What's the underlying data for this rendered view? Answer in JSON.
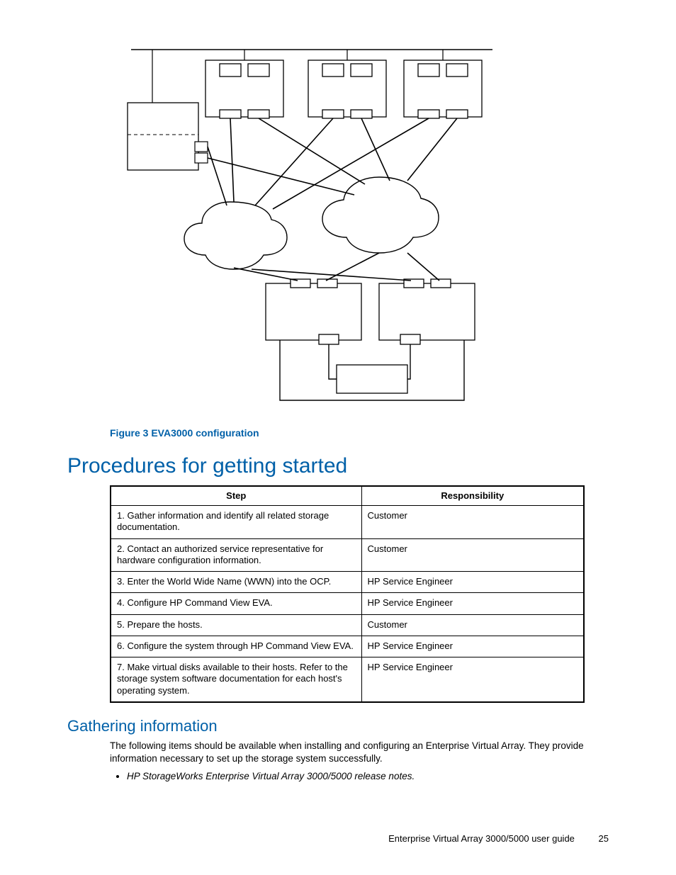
{
  "figure_caption": "Figure 3 EVA3000 configuration",
  "section_heading": "Procedures for getting started",
  "table": {
    "headers": {
      "step": "Step",
      "resp": "Responsibility"
    },
    "rows": [
      {
        "step": "1.  Gather information and identify all related storage documentation.",
        "resp": "Customer"
      },
      {
        "step": "2.  Contact an authorized service representative for hardware configuration information.",
        "resp": "Customer"
      },
      {
        "step": "3.  Enter the World Wide Name (WWN) into the OCP.",
        "resp": "HP Service Engineer"
      },
      {
        "step": "4.  Configure HP Command View EVA.",
        "resp": "HP Service Engineer"
      },
      {
        "step": "5.  Prepare the hosts.",
        "resp": "Customer"
      },
      {
        "step": "6.  Configure the system through HP Command View EVA.",
        "resp": "HP Service Engineer"
      },
      {
        "step": "7.  Make virtual disks available to their hosts.  Refer to the storage system software documentation for each host's operating system.",
        "resp": "HP Service Engineer"
      }
    ]
  },
  "subheading": "Gathering information",
  "body_para": "The following items should be available when installing and configuring an Enterprise Virtual Array.  They provide information necessary to set up the storage system successfully.",
  "bullets": [
    "HP StorageWorks Enterprise Virtual Array 3000/5000 release notes."
  ],
  "footer_text": "Enterprise Virtual Array 3000/5000 user guide",
  "page_number": "25"
}
